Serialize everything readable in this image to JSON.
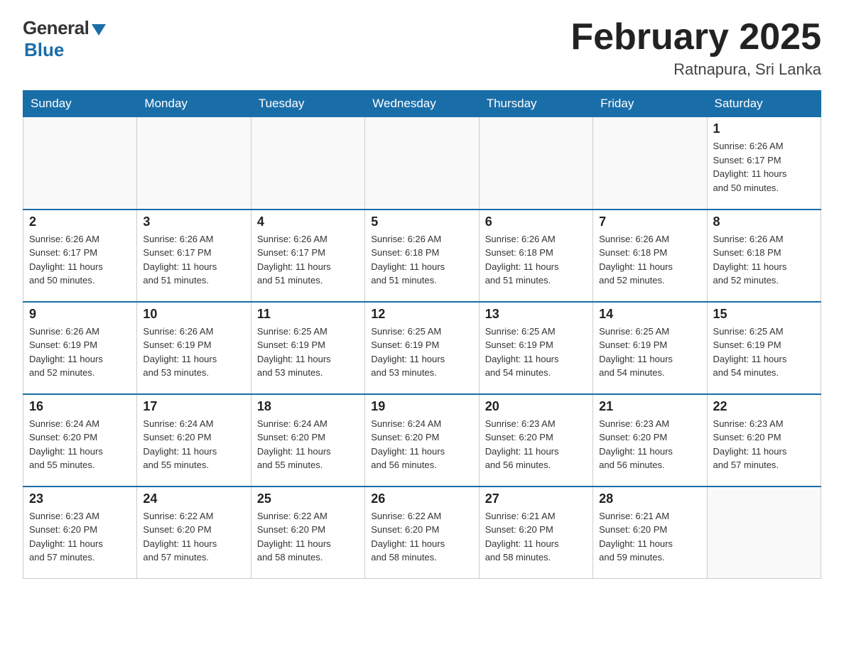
{
  "header": {
    "logo_general": "General",
    "logo_blue": "Blue",
    "month_title": "February 2025",
    "location": "Ratnapura, Sri Lanka"
  },
  "days_of_week": [
    "Sunday",
    "Monday",
    "Tuesday",
    "Wednesday",
    "Thursday",
    "Friday",
    "Saturday"
  ],
  "weeks": [
    [
      {
        "day": "",
        "info": ""
      },
      {
        "day": "",
        "info": ""
      },
      {
        "day": "",
        "info": ""
      },
      {
        "day": "",
        "info": ""
      },
      {
        "day": "",
        "info": ""
      },
      {
        "day": "",
        "info": ""
      },
      {
        "day": "1",
        "info": "Sunrise: 6:26 AM\nSunset: 6:17 PM\nDaylight: 11 hours\nand 50 minutes."
      }
    ],
    [
      {
        "day": "2",
        "info": "Sunrise: 6:26 AM\nSunset: 6:17 PM\nDaylight: 11 hours\nand 50 minutes."
      },
      {
        "day": "3",
        "info": "Sunrise: 6:26 AM\nSunset: 6:17 PM\nDaylight: 11 hours\nand 51 minutes."
      },
      {
        "day": "4",
        "info": "Sunrise: 6:26 AM\nSunset: 6:17 PM\nDaylight: 11 hours\nand 51 minutes."
      },
      {
        "day": "5",
        "info": "Sunrise: 6:26 AM\nSunset: 6:18 PM\nDaylight: 11 hours\nand 51 minutes."
      },
      {
        "day": "6",
        "info": "Sunrise: 6:26 AM\nSunset: 6:18 PM\nDaylight: 11 hours\nand 51 minutes."
      },
      {
        "day": "7",
        "info": "Sunrise: 6:26 AM\nSunset: 6:18 PM\nDaylight: 11 hours\nand 52 minutes."
      },
      {
        "day": "8",
        "info": "Sunrise: 6:26 AM\nSunset: 6:18 PM\nDaylight: 11 hours\nand 52 minutes."
      }
    ],
    [
      {
        "day": "9",
        "info": "Sunrise: 6:26 AM\nSunset: 6:19 PM\nDaylight: 11 hours\nand 52 minutes."
      },
      {
        "day": "10",
        "info": "Sunrise: 6:26 AM\nSunset: 6:19 PM\nDaylight: 11 hours\nand 53 minutes."
      },
      {
        "day": "11",
        "info": "Sunrise: 6:25 AM\nSunset: 6:19 PM\nDaylight: 11 hours\nand 53 minutes."
      },
      {
        "day": "12",
        "info": "Sunrise: 6:25 AM\nSunset: 6:19 PM\nDaylight: 11 hours\nand 53 minutes."
      },
      {
        "day": "13",
        "info": "Sunrise: 6:25 AM\nSunset: 6:19 PM\nDaylight: 11 hours\nand 54 minutes."
      },
      {
        "day": "14",
        "info": "Sunrise: 6:25 AM\nSunset: 6:19 PM\nDaylight: 11 hours\nand 54 minutes."
      },
      {
        "day": "15",
        "info": "Sunrise: 6:25 AM\nSunset: 6:19 PM\nDaylight: 11 hours\nand 54 minutes."
      }
    ],
    [
      {
        "day": "16",
        "info": "Sunrise: 6:24 AM\nSunset: 6:20 PM\nDaylight: 11 hours\nand 55 minutes."
      },
      {
        "day": "17",
        "info": "Sunrise: 6:24 AM\nSunset: 6:20 PM\nDaylight: 11 hours\nand 55 minutes."
      },
      {
        "day": "18",
        "info": "Sunrise: 6:24 AM\nSunset: 6:20 PM\nDaylight: 11 hours\nand 55 minutes."
      },
      {
        "day": "19",
        "info": "Sunrise: 6:24 AM\nSunset: 6:20 PM\nDaylight: 11 hours\nand 56 minutes."
      },
      {
        "day": "20",
        "info": "Sunrise: 6:23 AM\nSunset: 6:20 PM\nDaylight: 11 hours\nand 56 minutes."
      },
      {
        "day": "21",
        "info": "Sunrise: 6:23 AM\nSunset: 6:20 PM\nDaylight: 11 hours\nand 56 minutes."
      },
      {
        "day": "22",
        "info": "Sunrise: 6:23 AM\nSunset: 6:20 PM\nDaylight: 11 hours\nand 57 minutes."
      }
    ],
    [
      {
        "day": "23",
        "info": "Sunrise: 6:23 AM\nSunset: 6:20 PM\nDaylight: 11 hours\nand 57 minutes."
      },
      {
        "day": "24",
        "info": "Sunrise: 6:22 AM\nSunset: 6:20 PM\nDaylight: 11 hours\nand 57 minutes."
      },
      {
        "day": "25",
        "info": "Sunrise: 6:22 AM\nSunset: 6:20 PM\nDaylight: 11 hours\nand 58 minutes."
      },
      {
        "day": "26",
        "info": "Sunrise: 6:22 AM\nSunset: 6:20 PM\nDaylight: 11 hours\nand 58 minutes."
      },
      {
        "day": "27",
        "info": "Sunrise: 6:21 AM\nSunset: 6:20 PM\nDaylight: 11 hours\nand 58 minutes."
      },
      {
        "day": "28",
        "info": "Sunrise: 6:21 AM\nSunset: 6:20 PM\nDaylight: 11 hours\nand 59 minutes."
      },
      {
        "day": "",
        "info": ""
      }
    ]
  ]
}
